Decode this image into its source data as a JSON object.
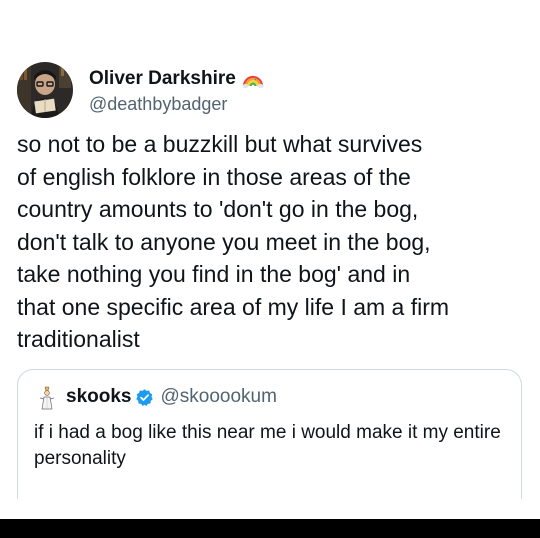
{
  "author": {
    "display_name": "Oliver Darkshire",
    "handle": "@deathbybadger",
    "avatar_icon": "person-reading-avatar",
    "badge_icon": "rainbow-icon"
  },
  "tweet": {
    "text": "so not to be a buzzkill but what survives\nof english folklore in those areas of the\ncountry amounts to 'don't go in the bog,\ndon't talk to anyone you meet in the bog,\ntake nothing you find in the bog' and in\nthat one specific area of my life I am a firm\ntraditionalist"
  },
  "quoted_tweet": {
    "display_name": "skooks",
    "handle": "@skooookum",
    "avatar_icon": "tiny-figure-avatar",
    "verified_icon": "verified-badge-icon",
    "text": "if i had a bog like this near me i would make it my entire personality"
  },
  "colors": {
    "text_primary": "#0f1419",
    "text_secondary": "#536471",
    "border": "#cfd9de",
    "verified_blue": "#1d9bf0"
  }
}
